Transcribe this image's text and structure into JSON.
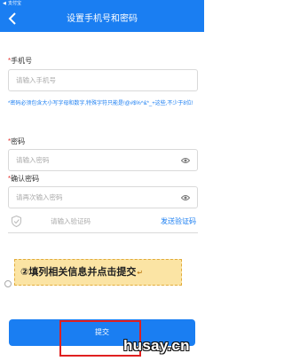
{
  "status_bar": {
    "app_name": "支付宝"
  },
  "header": {
    "title": "设置手机号和密码",
    "back_icon": "chevron-left-icon"
  },
  "phone": {
    "required_mark": "*",
    "label": "手机号",
    "placeholder": "请输入手机号"
  },
  "password_hint": "*密码必须包含大小写字母和数字,特殊字符只能是!@#$%^&*_+这些,不少于8位!",
  "password": {
    "required_mark": "*",
    "label": "密码",
    "placeholder": "请输入密码"
  },
  "confirm_password": {
    "required_mark": "*",
    "label": "确认密码",
    "placeholder": "请再次输入密码"
  },
  "verify": {
    "placeholder": "请输入验证码",
    "send_label": "发送验证码"
  },
  "annotation": {
    "text": "②填列相关信息并点击提交",
    "mark": "↵"
  },
  "submit": {
    "label": "提交"
  },
  "watermark": "husay.cn",
  "colors": {
    "brand": "#1a7ef2",
    "required": "#e53935",
    "highlight": "#e02020",
    "annotation_bg": "#fbe4a4"
  }
}
